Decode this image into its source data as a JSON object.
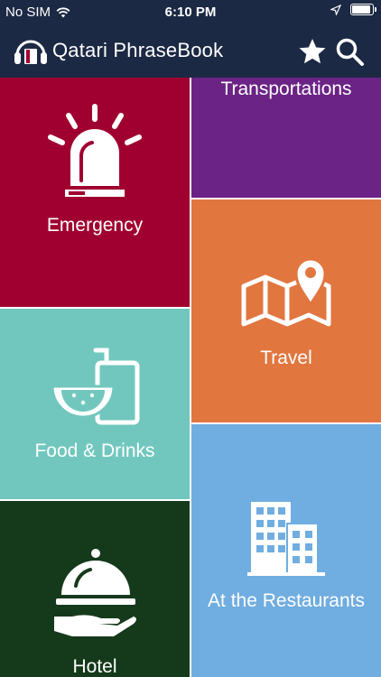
{
  "status_bar": {
    "carrier": "No SIM",
    "time": "6:10 PM"
  },
  "header": {
    "title": "Qatari PhraseBook",
    "logo_icon": "headphones-book-icon",
    "favorites_icon": "star-icon",
    "search_icon": "search-icon"
  },
  "tiles": [
    {
      "label": "Emergency",
      "icon": "siren-icon",
      "color": "#a0002f"
    },
    {
      "label": "Transportations",
      "icon": "",
      "color": "#6b2385"
    },
    {
      "label": "Travel",
      "icon": "map-pin-icon",
      "color": "#e1763f"
    },
    {
      "label": "Food & Drinks",
      "icon": "watermelon-drink-icon",
      "color": "#71c7be"
    },
    {
      "label": "At the Restaurants",
      "icon": "building-icon",
      "color": "#70ade0"
    },
    {
      "label": "Hotel",
      "icon": "cloche-tray-icon",
      "color": "#153a1b"
    }
  ],
  "colors": {
    "header_bg": "#1c2944"
  }
}
